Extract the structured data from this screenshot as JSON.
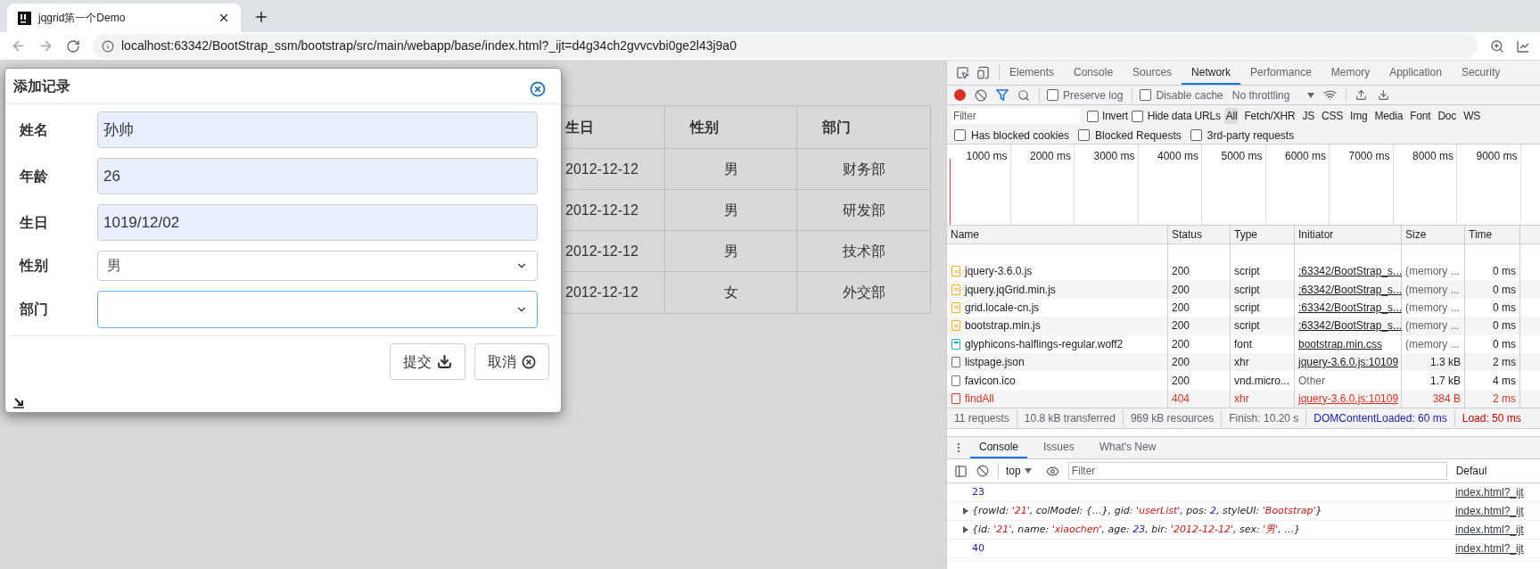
{
  "browser": {
    "tab": {
      "title": "jqgrid第一个Demo"
    },
    "url": "localhost:63342/BootStrap_ssm/bootstrap/src/main/webapp/base/index.html?_ijt=d4g34ch2gvvcvbi0ge2l43j9a0"
  },
  "table": {
    "columns": [
      "生日",
      "性别",
      "部门"
    ],
    "rows": [
      [
        "2012-12-12",
        "男",
        "财务部"
      ],
      [
        "2012-12-12",
        "男",
        "研发部"
      ],
      [
        "2012-12-12",
        "男",
        "技术部"
      ],
      [
        "2012-12-12",
        "女",
        "外交部"
      ]
    ]
  },
  "dialog": {
    "title": "添加记录",
    "fields": [
      {
        "label": "姓名",
        "kind": "input",
        "value": "孙帅",
        "autofilled": true,
        "focused": false
      },
      {
        "label": "年龄",
        "kind": "input",
        "value": "26",
        "autofilled": true,
        "focused": false
      },
      {
        "label": "生日",
        "kind": "input",
        "value": "1019/12/02",
        "autofilled": true,
        "focused": false
      },
      {
        "label": "性别",
        "kind": "select",
        "value": "男",
        "autofilled": false,
        "focused": false
      },
      {
        "label": "部门",
        "kind": "select",
        "autofilled": false,
        "focused": true
      }
    ],
    "buttons": [
      {
        "label": "提交",
        "kind": "submit"
      },
      {
        "label": "取消",
        "kind": "cancel"
      }
    ]
  },
  "devtools": {
    "tabs": [
      {
        "label": "Elements",
        "selected": false
      },
      {
        "label": "Console",
        "selected": false
      },
      {
        "label": "Sources",
        "selected": false
      },
      {
        "label": "Network",
        "selected": true
      },
      {
        "label": "Performance",
        "selected": false
      },
      {
        "label": "Memory",
        "selected": false
      },
      {
        "label": "Application",
        "selected": false
      },
      {
        "label": "Security",
        "selected": false
      }
    ],
    "toolbar": {
      "preserve_log": {
        "label": "Preserve log",
        "checked": false
      },
      "disable_cache": {
        "label": "Disable cache",
        "checked": false
      },
      "throttling": "No throttling"
    },
    "filter": {
      "placeholder": "Filter",
      "invert": {
        "label": "Invert",
        "checked": false
      },
      "hide_data_urls": {
        "label": "Hide data URLs",
        "checked": false
      },
      "types": [
        {
          "label": "All",
          "selected": true
        },
        {
          "label": "Fetch/XHR",
          "selected": false
        },
        {
          "label": "JS",
          "selected": false
        },
        {
          "label": "CSS",
          "selected": false
        },
        {
          "label": "Img",
          "selected": false
        },
        {
          "label": "Media",
          "selected": false
        },
        {
          "label": "Font",
          "selected": false
        },
        {
          "label": "Doc",
          "selected": false
        },
        {
          "label": "WS",
          "selected": false
        }
      ]
    },
    "blocked": [
      {
        "label": "Has blocked cookies",
        "checked": false
      },
      {
        "label": "Blocked Requests",
        "checked": false
      },
      {
        "label": "3rd-party requests",
        "checked": false
      }
    ],
    "timeline_ticks": [
      "1000 ms",
      "2000 ms",
      "3000 ms",
      "4000 ms",
      "5000 ms",
      "6000 ms",
      "7000 ms",
      "8000 ms",
      "9000 ms"
    ],
    "network": {
      "columns": [
        "Name",
        "Status",
        "Type",
        "Initiator",
        "Size",
        "Time"
      ],
      "rows": [
        {
          "name": "jquery-3.6.0.js",
          "kind": "script",
          "status": "200",
          "type": "script",
          "initiator": ":63342/BootStrap_s...",
          "size": "(memory ...",
          "time": "0 ms",
          "error": false
        },
        {
          "name": "jquery.jqGrid.min.js",
          "kind": "script",
          "status": "200",
          "type": "script",
          "initiator": ":63342/BootStrap_s...",
          "size": "(memory ...",
          "time": "0 ms",
          "error": false
        },
        {
          "name": "grid.locale-cn.js",
          "kind": "script",
          "status": "200",
          "type": "script",
          "initiator": ":63342/BootStrap_s...",
          "size": "(memory ...",
          "time": "0 ms",
          "error": false
        },
        {
          "name": "bootstrap.min.js",
          "kind": "script",
          "status": "200",
          "type": "script",
          "initiator": ":63342/BootStrap_s...",
          "size": "(memory ...",
          "time": "0 ms",
          "error": false
        },
        {
          "name": "glyphicons-halflings-regular.woff2",
          "kind": "font",
          "status": "200",
          "type": "font",
          "initiator": "bootstrap.min.css",
          "size": "(memory ...",
          "time": "0 ms",
          "error": false
        },
        {
          "name": "listpage.json",
          "kind": "other",
          "status": "200",
          "type": "xhr",
          "initiator": "jquery-3.6.0.js:10109",
          "size": "1.3 kB",
          "time": "2 ms",
          "error": false
        },
        {
          "name": "favicon.ico",
          "kind": "other",
          "status": "200",
          "type": "vnd.micro...",
          "initiator": "Other",
          "initiator_link": false,
          "size": "1.7 kB",
          "time": "4 ms",
          "error": false
        },
        {
          "name": "findAll",
          "kind": "other",
          "status": "404",
          "type": "xhr",
          "initiator": "jquery-3.6.0.js:10109",
          "size": "384 B",
          "time": "2 ms",
          "error": true
        }
      ]
    },
    "summary": [
      {
        "text": "11 requests",
        "kind": "plain"
      },
      {
        "text": "10.8 kB transferred",
        "kind": "plain"
      },
      {
        "text": "969 kB resources",
        "kind": "plain"
      },
      {
        "text": "Finish: 10.20 s",
        "kind": "plain"
      },
      {
        "text": "DOMContentLoaded: 60 ms",
        "kind": "dom"
      },
      {
        "text": "Load: 50 ms",
        "kind": "load"
      }
    ],
    "drawer": {
      "tabs": [
        {
          "label": "Console",
          "selected": true
        },
        {
          "label": "Issues",
          "selected": false
        },
        {
          "label": "What's New",
          "selected": false
        }
      ],
      "context": "top",
      "filter_placeholder": "Filter",
      "levels": "Defaul",
      "lines": [
        {
          "kind": "number",
          "tokens": [
            {
              "text": "23",
              "kind": "number"
            }
          ],
          "source": "index.html?_ijt"
        },
        {
          "kind": "object",
          "tokens": [
            {
              "text": "{rowId: ",
              "kind": "plain"
            },
            {
              "text": "'21'",
              "kind": "string"
            },
            {
              "text": ", colModel: {…}, gid: ",
              "kind": "plain"
            },
            {
              "text": "'userList'",
              "kind": "string"
            },
            {
              "text": ", pos: ",
              "kind": "plain"
            },
            {
              "text": "2",
              "kind": "number"
            },
            {
              "text": ", styleUI: ",
              "kind": "plain"
            },
            {
              "text": "'Bootstrap'",
              "kind": "string"
            },
            {
              "text": "}",
              "kind": "plain"
            }
          ],
          "source": "index.html?_ijt"
        },
        {
          "kind": "object",
          "tokens": [
            {
              "text": "{id: ",
              "kind": "plain"
            },
            {
              "text": "'21'",
              "kind": "string"
            },
            {
              "text": ", name: ",
              "kind": "plain"
            },
            {
              "text": "'xiaochen'",
              "kind": "string"
            },
            {
              "text": ", age: ",
              "kind": "plain"
            },
            {
              "text": "23",
              "kind": "number"
            },
            {
              "text": ", bir: ",
              "kind": "plain"
            },
            {
              "text": "'2012-12-12'",
              "kind": "string"
            },
            {
              "text": ", sex: ",
              "kind": "plain"
            },
            {
              "text": "'男'",
              "kind": "string"
            },
            {
              "text": ", …}",
              "kind": "plain"
            }
          ],
          "source": "index.html?_ijt"
        },
        {
          "kind": "number",
          "tokens": [
            {
              "text": "40",
              "kind": "number"
            }
          ],
          "source": "index.html?_ijt"
        }
      ]
    }
  }
}
